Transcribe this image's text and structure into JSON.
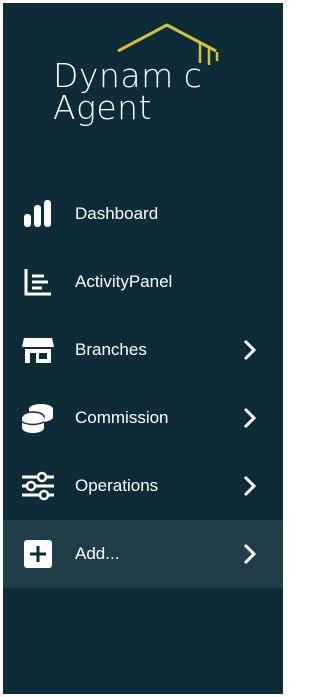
{
  "brand": {
    "line1": "Dynam",
    "line1_end": "c",
    "line2": "Agent",
    "accent_color": "#d4c13a",
    "icon": "house-roof-icon"
  },
  "nav": {
    "items": [
      {
        "label": "Dashboard",
        "icon": "bar-chart-icon",
        "has_submenu": false
      },
      {
        "label": "ActivityPanel",
        "icon": "line-list-icon",
        "has_submenu": false
      },
      {
        "label": "Branches",
        "icon": "store-icon",
        "has_submenu": true
      },
      {
        "label": "Commission",
        "icon": "coins-icon",
        "has_submenu": true
      },
      {
        "label": "Operations",
        "icon": "sliders-icon",
        "has_submenu": true
      },
      {
        "label": "Add...",
        "icon": "plus-square-icon",
        "has_submenu": true,
        "active": true
      }
    ]
  },
  "colors": {
    "sidebar_bg": "#0e2c37",
    "active_bg": "#1f3e48",
    "text": "#ffffff"
  }
}
